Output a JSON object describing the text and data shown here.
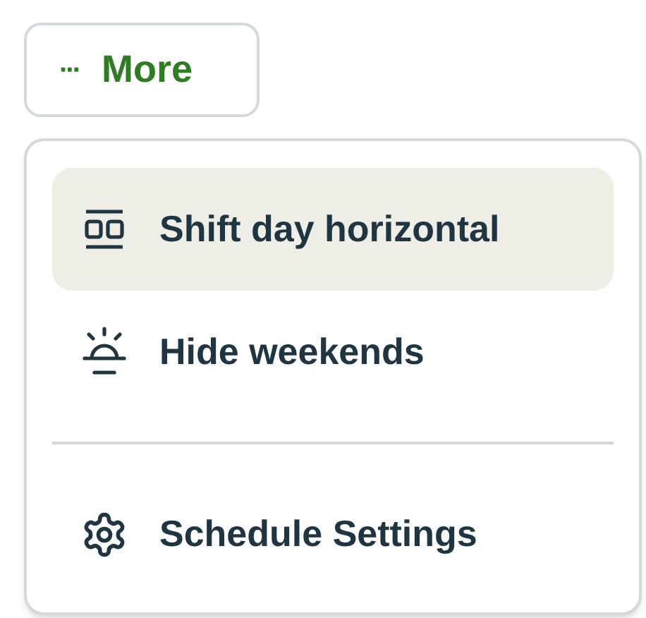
{
  "more_button": {
    "icon": "···",
    "label": "More"
  },
  "menu": {
    "items": [
      {
        "kind": "action",
        "label": "Shift day horizontal",
        "selected": true
      },
      {
        "kind": "action",
        "label": "Hide weekends",
        "selected": false
      },
      {
        "kind": "divider"
      },
      {
        "kind": "action",
        "label": "Schedule Settings",
        "selected": false
      }
    ]
  }
}
